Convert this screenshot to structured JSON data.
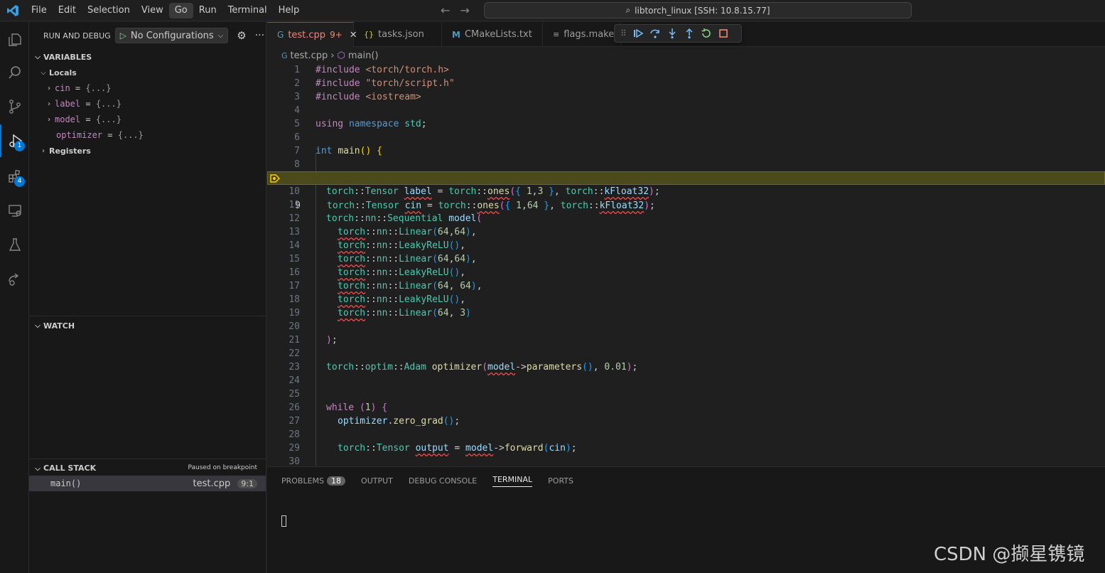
{
  "menu": [
    "File",
    "Edit",
    "Selection",
    "View",
    "Go",
    "Run",
    "Terminal",
    "Help"
  ],
  "command_center": "libtorch_linux [SSH: 10.8.15.77]",
  "activity": {
    "debug_badge": "1",
    "extensions_badge": "4"
  },
  "sidebar": {
    "title": "RUN AND DEBUG",
    "config": "No Configurations",
    "variables_title": "VARIABLES",
    "locals_label": "Locals",
    "locals": [
      {
        "name": "cin",
        "value": "{...}"
      },
      {
        "name": "label",
        "value": "{...}"
      },
      {
        "name": "model",
        "value": "{...}"
      },
      {
        "name": "optimizer",
        "value": "{...}"
      }
    ],
    "registers_label": "Registers",
    "watch_title": "WATCH",
    "callstack_title": "CALL STACK",
    "callstack_status": "Paused on breakpoint",
    "frame": {
      "fn": "main()",
      "file": "test.cpp",
      "pos": "9:1"
    }
  },
  "tabs": [
    {
      "label": "test.cpp",
      "badge": "9+",
      "icon": "cpp-icon"
    },
    {
      "label": "tasks.json",
      "icon": "json-icon"
    },
    {
      "label": "CMakeLists.txt",
      "icon": "cmake-icon"
    },
    {
      "label": "flags.make",
      "icon": "file-lines-icon"
    }
  ],
  "breadcrumb": {
    "file": "test.cpp",
    "symbol": "main()"
  },
  "editor": {
    "current_line": 9,
    "line_numbers": [
      "1",
      "2",
      "3",
      "4",
      "5",
      "6",
      "7",
      "8",
      "9",
      "10",
      "11",
      "12",
      "13",
      "14",
      "15",
      "16",
      "17",
      "18",
      "19",
      "20",
      "21",
      "22",
      "23",
      "24",
      "25",
      "26",
      "27",
      "28",
      "29",
      "30"
    ]
  },
  "panel": {
    "tabs": [
      "PROBLEMS",
      "OUTPUT",
      "DEBUG CONSOLE",
      "TERMINAL",
      "PORTS"
    ],
    "problems_count": "18",
    "active": "TERMINAL"
  },
  "watermark": "CSDN @撷星镌镜"
}
